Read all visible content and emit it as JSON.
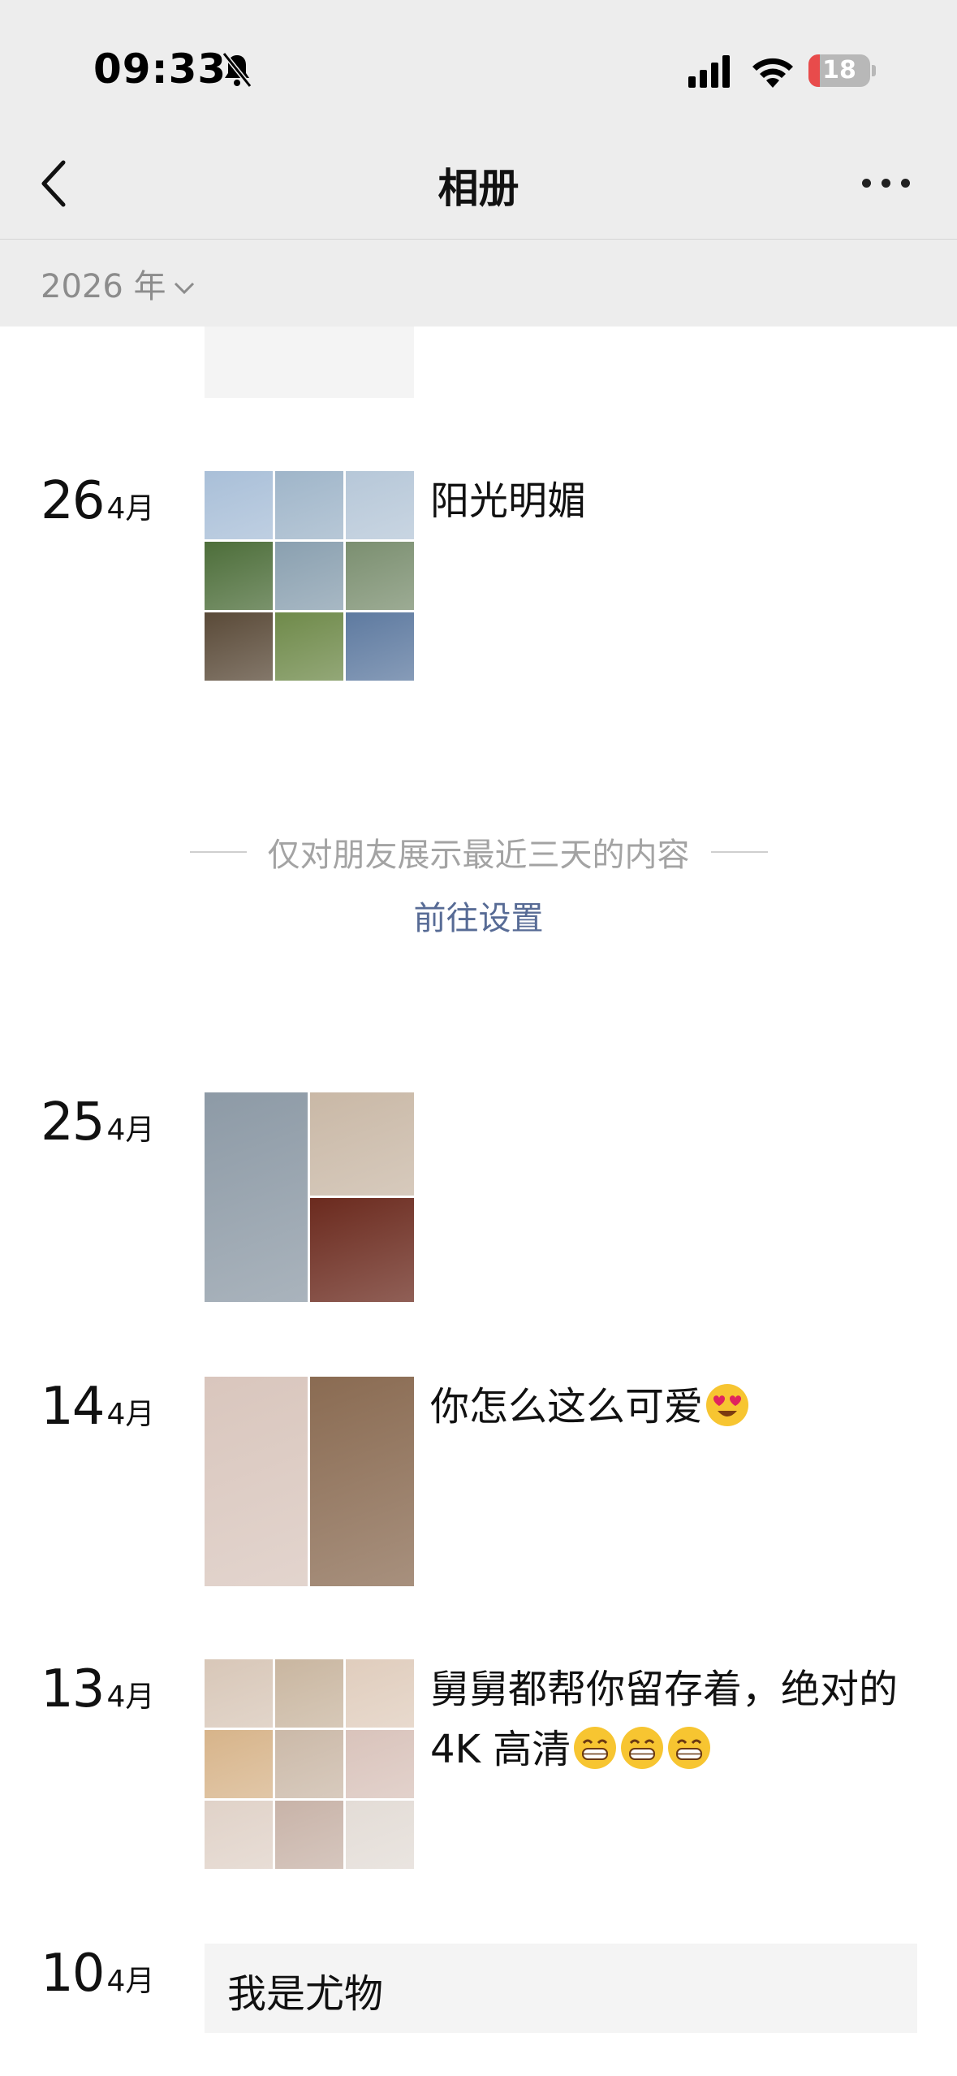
{
  "status_bar": {
    "time": "09:33",
    "battery": "18",
    "battery_level_fraction": 0.18,
    "icons": [
      "bell-muted-icon",
      "cellular-signal-icon",
      "wifi-icon",
      "battery-icon"
    ]
  },
  "nav": {
    "title": "相册",
    "back_icon": "chevron-left-icon",
    "more_icon": "more-dots-icon"
  },
  "filter": {
    "year_label": "2026 年",
    "dropdown_icon": "chevron-down-icon"
  },
  "notice": {
    "text": "仅对朋友展示最近三天的内容",
    "link": "前往设置"
  },
  "posts": [
    {
      "day": "26",
      "month": "4月",
      "text": "阳光明媚",
      "photo_count": 9,
      "photo_colors": [
        "#a9bfd8",
        "#9fb5c9",
        "#b6c7d8",
        "#4d6e3a",
        "#8aa0b0",
        "#7b8f70",
        "#5a4a38",
        "#6f8a4a",
        "#5e7aa0"
      ]
    },
    {
      "day": "25",
      "month": "4月",
      "text": "",
      "photo_count": 3,
      "photo_colors": [
        "#8d9aa6",
        "#c9b8a6",
        "#6b2a1e"
      ]
    },
    {
      "day": "14",
      "month": "4月",
      "text": "你怎么这么可爱",
      "emoji": [
        "heart-eyes-emoji"
      ],
      "photo_count": 2,
      "photo_colors": [
        "#d9c6bd",
        "#8a6b52"
      ]
    },
    {
      "day": "13",
      "month": "4月",
      "text": "舅舅都帮你留存着，绝对的 4K 高清",
      "emoji": [
        "grinning-emoji",
        "grinning-emoji",
        "grinning-emoji"
      ],
      "photo_count": 9,
      "photo_colors": [
        "#d8c7b8",
        "#c9b6a0",
        "#e0cdbd",
        "#d7b48a",
        "#cbb9a8",
        "#d9c3bb",
        "#e0d2c8",
        "#c8b3a8",
        "#e3dcd6"
      ]
    },
    {
      "day": "10",
      "month": "4月",
      "text": "我是尤物"
    }
  ]
}
